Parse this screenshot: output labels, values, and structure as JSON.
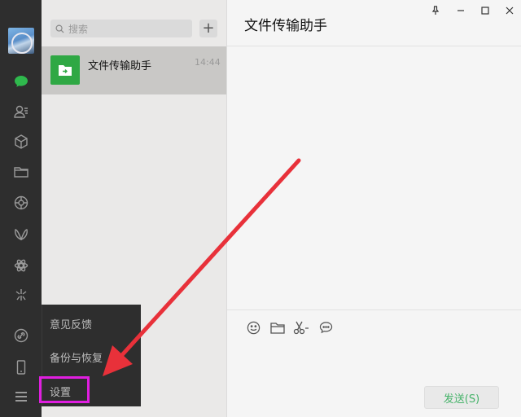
{
  "sidebar": {
    "icons": [
      "avatar",
      "chat-icon",
      "contacts-icon",
      "cube-icon",
      "folder-icon",
      "moments-icon",
      "butterfly-icon",
      "gear-flower-icon",
      "sparkle-icon",
      "link-icon",
      "phone-icon",
      "menu-icon"
    ]
  },
  "search": {
    "placeholder": "搜索",
    "add_label": "+"
  },
  "chats": [
    {
      "name": "文件传输助手",
      "time": "14:44"
    }
  ],
  "menu": {
    "items": [
      {
        "label": "意见反馈"
      },
      {
        "label": "备份与恢复"
      },
      {
        "label": "设置"
      }
    ],
    "highlight_color": "#e01ee0"
  },
  "window": {
    "title": "文件传输助手",
    "controls": [
      "pin-icon",
      "minimize-icon",
      "maximize-icon",
      "close-icon"
    ]
  },
  "composer": {
    "tools": [
      "emoji-icon",
      "folder-icon",
      "scissors-icon",
      "chat-bubble-icon"
    ],
    "send_label": "发送(S)"
  },
  "colors": {
    "rail_bg": "#2e2e2e",
    "list_bg": "#eae9e8",
    "selected_bg": "#c9c8c6",
    "accent_green": "#2fa844",
    "arrow_red": "#e8313a"
  }
}
